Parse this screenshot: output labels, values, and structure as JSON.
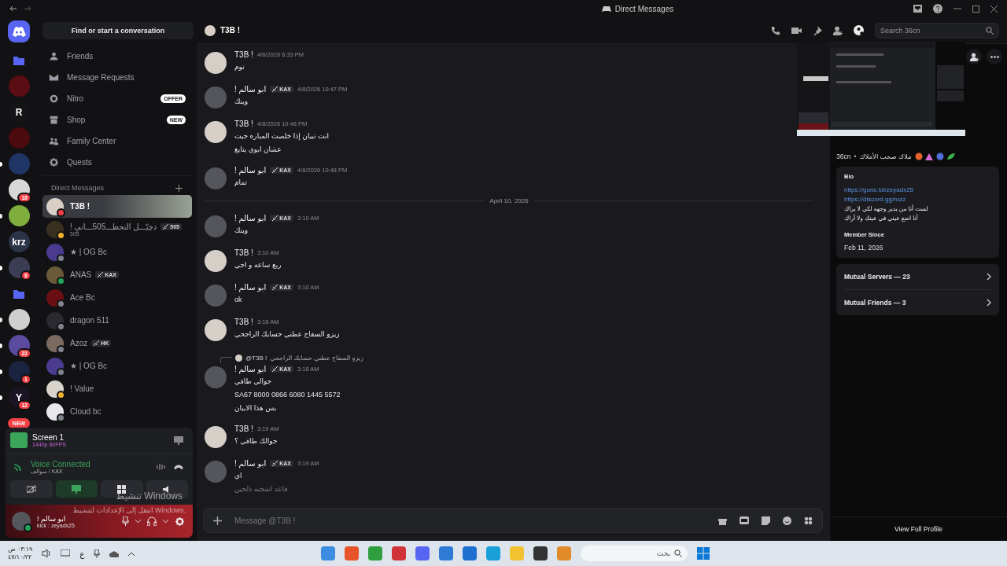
{
  "titlebar": {
    "title": "Direct Messages"
  },
  "rail": [
    {
      "kind": "folder",
      "unread": false
    },
    {
      "kind": "server",
      "color": "#5a0d12",
      "unread": false
    },
    {
      "kind": "server",
      "color": "#141416",
      "label": "R",
      "unread": false
    },
    {
      "kind": "server",
      "color": "#4a0a0e",
      "unread": false
    },
    {
      "kind": "server",
      "color": "#1f3566",
      "unread": true
    },
    {
      "kind": "server",
      "color": "#d8d8d8",
      "badge": "18",
      "unread": false
    },
    {
      "kind": "server",
      "color": "#7fae3e",
      "unread": true
    },
    {
      "kind": "server",
      "color": "#2b3348",
      "label": "krz",
      "unread": false
    },
    {
      "kind": "server",
      "color": "#3b3d55",
      "badge": "8",
      "unread": true
    },
    {
      "kind": "folder",
      "unread": false
    },
    {
      "kind": "server",
      "color": "#cfcfcf",
      "unread": true
    },
    {
      "kind": "server",
      "color": "#5a4aa0",
      "badge": "22",
      "unread": true
    },
    {
      "kind": "server",
      "color": "#1a2440",
      "badge": "1",
      "unread": true
    },
    {
      "kind": "server",
      "color": "#1b1424",
      "label": "Y",
      "badge": "12",
      "unread": true
    },
    {
      "kind": "pill",
      "label": "NEW",
      "unread": false
    }
  ],
  "sidebar": {
    "search_button": "Find or start a conversation",
    "nav": [
      {
        "label": "Friends"
      },
      {
        "label": "Message Requests"
      },
      {
        "label": "Nitro",
        "tag": "OFFER"
      },
      {
        "label": "Shop",
        "tag": "NEW"
      },
      {
        "label": "Family Center"
      },
      {
        "label": "Quests"
      }
    ],
    "dm_heading": "Direct Messages",
    "dms": [
      {
        "name": "T3B !",
        "selected": true,
        "color": "#f23f43"
      },
      {
        "name": "! دخِيّـــل التحطـــ505ـــاني",
        "subtitle": "505",
        "tag": "505",
        "selected": false,
        "color": "#f0b232"
      },
      {
        "name": "★ | OG Bc",
        "selected": false,
        "color": "#80848e"
      },
      {
        "name": "ANAS",
        "tag": "KAX",
        "selected": false,
        "color": "#23a55a"
      },
      {
        "name": "Ace Bc",
        "selected": false,
        "color": "#80848e"
      },
      {
        "name": "dragon 511",
        "selected": false,
        "color": "#80848e"
      },
      {
        "name": "Azoz",
        "tag": "HK",
        "selected": false,
        "color": "#80848e"
      },
      {
        "name": "★ | OG Bc",
        "selected": false,
        "color": "#80848e"
      },
      {
        "name": "! Value",
        "selected": false,
        "color": "#f0b232"
      },
      {
        "name": "Cloud bc",
        "selected": false,
        "color": "#80848e"
      }
    ]
  },
  "stream": {
    "title": "Screen 1",
    "quality": "1440p 60FPS"
  },
  "voice": {
    "status": "Voice Connected",
    "channel": "سوالف / KAX"
  },
  "user": {
    "name": "! ابو سالم",
    "status": "kick : zeyadx25"
  },
  "os_notice": {
    "title": "تنشيط Windows",
    "text": "انتقل إلى الإعدادات لتنشيط Windows."
  },
  "chat": {
    "header": "T3B !",
    "search_placeholder": "Search 36cn",
    "input_placeholder": "Message @T3B !",
    "items": [
      {
        "kind": "message",
        "author": "T3B !",
        "time": "4/8/2026 6:33 PM",
        "color": "#d6cfc8",
        "lines": [
          "نوم"
        ]
      },
      {
        "kind": "message",
        "author": "! ابو سالم",
        "tag": "KAX",
        "time": "4/8/2026 10:47 PM",
        "color": "#55565c",
        "lines": [
          "وينك"
        ]
      },
      {
        "kind": "message",
        "author": "T3B !",
        "time": "4/8/2026 10:48 PM",
        "color": "#d6cfc8",
        "lines": [
          "انت تبيان إذا خلصت المباره جيت",
          "عشان ابوي يتابع"
        ]
      },
      {
        "kind": "message",
        "author": "! ابو سالم",
        "tag": "KAX",
        "time": "4/8/2026 10:48 PM",
        "color": "#55565c",
        "lines": [
          "تمام"
        ]
      },
      {
        "kind": "divider",
        "label": "April 10, 2026"
      },
      {
        "kind": "message",
        "author": "! ابو سالم",
        "tag": "KAX",
        "time": "3:10 AM",
        "color": "#55565c",
        "lines": [
          "وينك"
        ]
      },
      {
        "kind": "message",
        "author": "T3B !",
        "time": "3:10 AM",
        "color": "#d6cfc8",
        "lines": [
          "ربع ساعه و اجي"
        ]
      },
      {
        "kind": "message",
        "author": "! ابو سالم",
        "tag": "KAX",
        "time": "3:10 AM",
        "color": "#55565c",
        "lines": [
          "ok"
        ]
      },
      {
        "kind": "message",
        "author": "T3B !",
        "time": "3:16 AM",
        "color": "#d6cfc8",
        "lines": [
          "زيزو السفاح عطني حسابك الراجحي"
        ]
      },
      {
        "kind": "message",
        "author": "! ابو سالم",
        "tag": "KAX",
        "time": "3:18 AM",
        "color": "#55565c",
        "reply": {
          "mention": "@T3B !",
          "text": "زيزو السفاح عطني حسابك الراجحي"
        },
        "lines": [
          "جوالي طافي",
          "SA67 8000 0866 6080 1445 5572",
          "بس هذا الايبان"
        ]
      },
      {
        "kind": "message",
        "author": "T3B !",
        "time": "3:19 AM",
        "color": "#d6cfc8",
        "lines": [
          "جوالك طافي ؟"
        ]
      },
      {
        "kind": "message",
        "author": "! ابو سالم",
        "tag": "KAX",
        "time": "3:19 AM",
        "color": "#55565c",
        "lines": [
          "اي"
        ],
        "pending_lines": [
          "قاعد اشحنه ذلحين"
        ]
      }
    ]
  },
  "profile": {
    "username": "36cn",
    "separator": "•",
    "about": "ملاك صحب الأملاك",
    "bio_heading": "Bio",
    "bio_links": [
      "https://guns.lol/zeyadx25",
      "https://discord.gg/rozz"
    ],
    "bio_lines": [
      "لست أنا من يدير وجهه لكي لا يراك",
      "أنا اضع عيني في عينك ولا أراك"
    ],
    "member_since_heading": "Member Since",
    "member_since": "Feb 11, 2026",
    "mutuals": [
      "Mutual Servers — 23",
      "Mutual Friends — 3"
    ],
    "view_full": "View Full Profile"
  },
  "taskbar": {
    "search_placeholder": "بحث",
    "language": "ع",
    "time": "٠٣:١٩ ص",
    "date": "٤٧/١٠/٢٢"
  }
}
